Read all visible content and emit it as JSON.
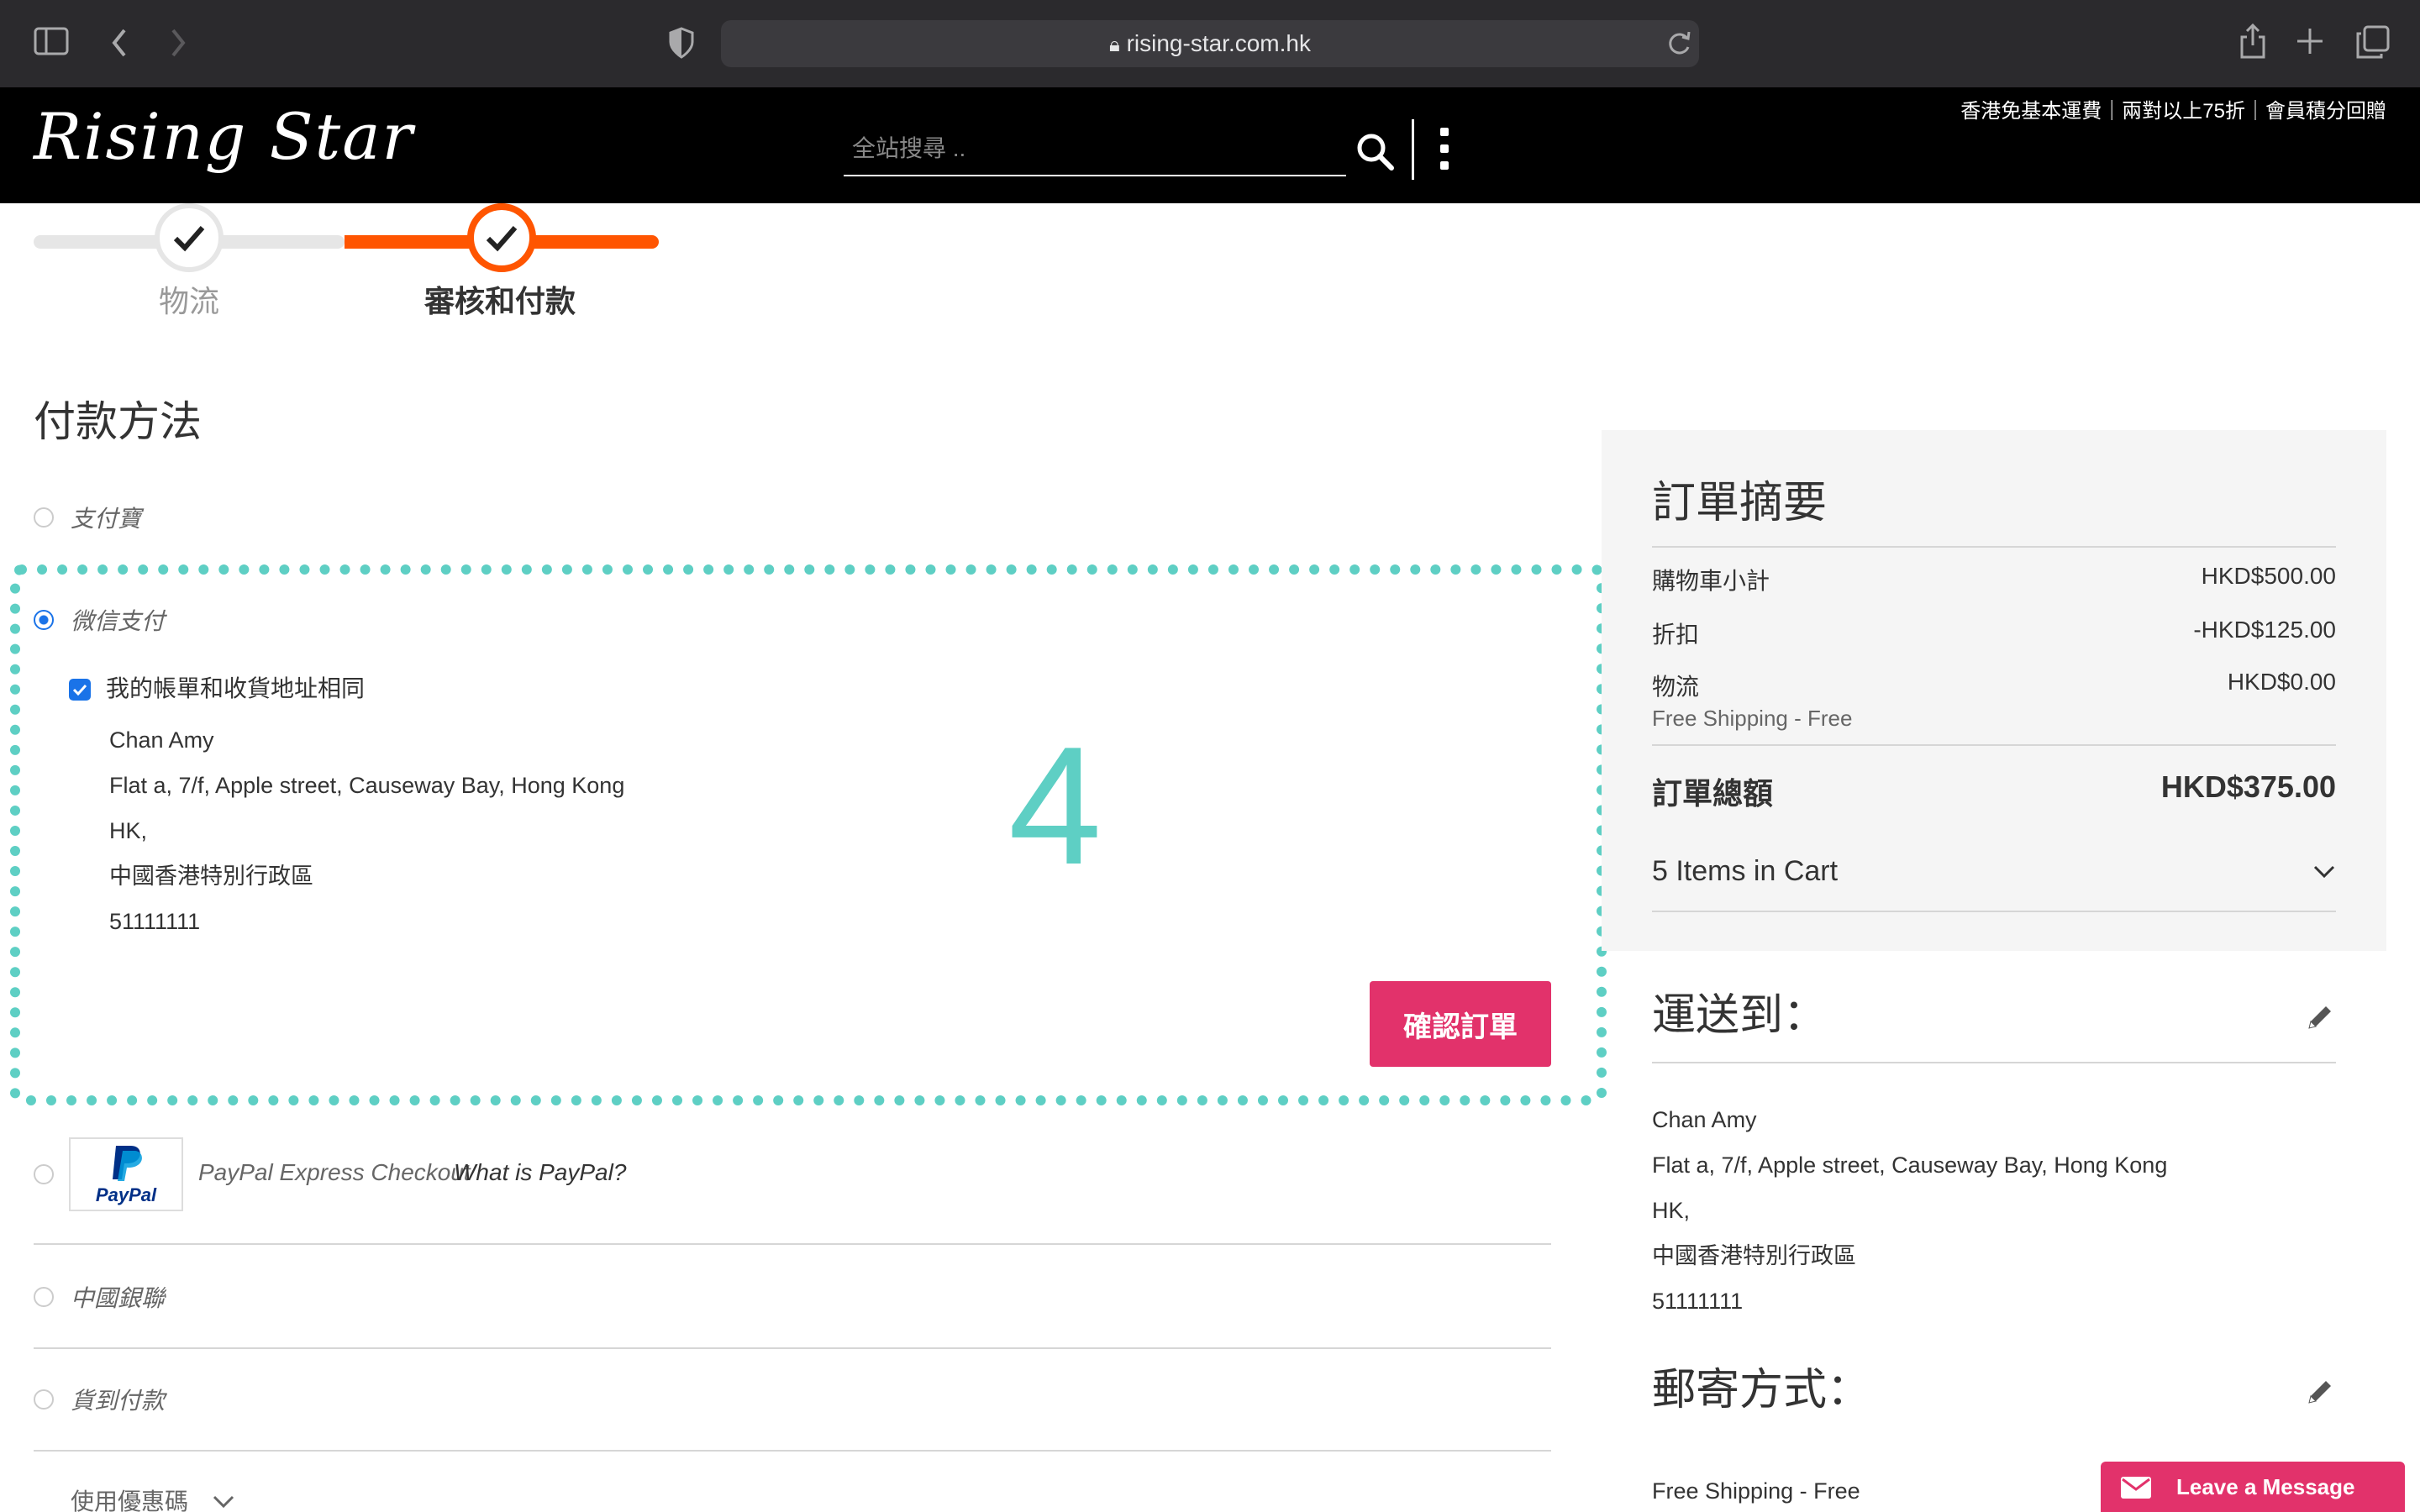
{
  "browser": {
    "url": "rising-star.com.hk"
  },
  "header": {
    "logo": "Rising Star",
    "search_placeholder": "全站搜尋 ..",
    "promo": "香港免基本運費｜兩對以上75折｜會員積分回贈"
  },
  "steps": [
    {
      "label": "物流",
      "state": "done"
    },
    {
      "label": "審核和付款",
      "state": "active"
    }
  ],
  "payment": {
    "title": "付款方法",
    "methods": [
      {
        "label": "支付寶",
        "selected": false
      },
      {
        "label": "微信支付",
        "selected": true
      },
      {
        "label": "PayPal Express Checkout",
        "link": "What is PayPal?",
        "logo": "PayPal",
        "selected": false
      },
      {
        "label": "中國銀聯",
        "selected": false
      },
      {
        "label": "貨到付款",
        "selected": false
      }
    ],
    "same_address_label": "我的帳單和收貨地址相同",
    "billing_address": [
      "Chan Amy",
      "Flat a, 7/f, Apple street, Causeway Bay, Hong Kong",
      "HK,",
      "中國香港特別行政區",
      "51111111"
    ],
    "confirm_label": "確認訂單",
    "annotation_number": "4",
    "coupon_label": "使用優惠碼"
  },
  "summary": {
    "title": "訂單摘要",
    "subtotal_label": "購物車小計",
    "subtotal_value": "HKD$500.00",
    "discount_label": "折扣",
    "discount_value": "-HKD$125.00",
    "shipping_label": "物流",
    "shipping_value": "HKD$0.00",
    "shipping_method": "Free Shipping - Free",
    "total_label": "訂單總額",
    "total_value": "HKD$375.00",
    "items_in_cart": "5 Items in Cart"
  },
  "ship_to": {
    "title": "運送到：",
    "address": [
      "Chan Amy",
      "Flat a, 7/f, Apple street, Causeway Bay, Hong Kong",
      "HK,",
      "中國香港特別行政區",
      "51111111"
    ]
  },
  "shipping_method": {
    "title": "郵寄方式：",
    "value": "Free Shipping - Free"
  },
  "chat": {
    "label": "Leave a Message"
  },
  "colors": {
    "accent_orange": "#ff5501",
    "confirm_pink": "#e2326b",
    "annotation_teal": "#5ecfc4",
    "radio_blue": "#1a73e8"
  }
}
